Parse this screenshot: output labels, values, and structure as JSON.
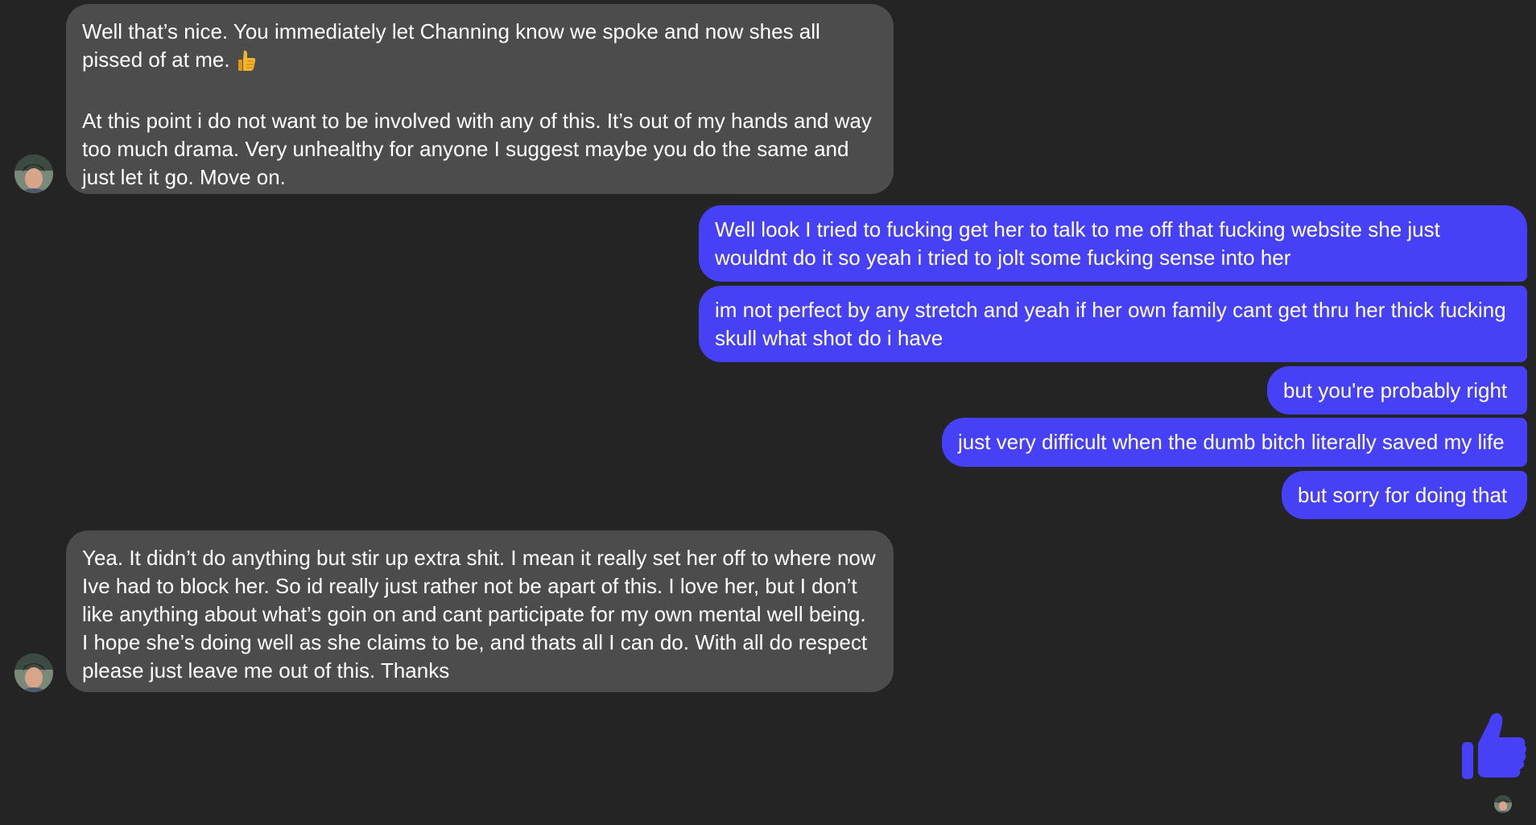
{
  "conversation": {
    "messages": [
      {
        "sender": "them",
        "text": "Well that’s nice. You immediately let Channing know we spoke and now shes all pissed of at me. ",
        "emoji": "thumbs-up",
        "text2": "\n\nAt this point i do not want to be involved with any of this. It’s out of my hands and way too much drama. Very unhealthy for anyone I suggest maybe you do the same and just let it go. Move on."
      },
      {
        "sender": "me",
        "text": "Well look I tried to fucking get her to talk to me off that fucking website she just wouldnt do it so yeah i tried to jolt some fucking sense into her"
      },
      {
        "sender": "me",
        "text": "im not perfect by any stretch and yeah if her own family cant get thru her thick fucking skull what shot do i have"
      },
      {
        "sender": "me",
        "text": "but you're probably right"
      },
      {
        "sender": "me",
        "text": "just very difficult when the dumb bitch literally saved my life"
      },
      {
        "sender": "me",
        "text": "but sorry for doing that"
      },
      {
        "sender": "them",
        "text": "Yea. It didn’t do anything but stir up extra shit. I mean it really set her off to where now Ive had to block her. So id really just rather not be apart of this. I love her, but I don’t like anything about what’s goin on and cant participate for my own mental well being. I hope she’s doing well as she claims to be, and thats all I can do. With all do respect please just leave me out of this. Thanks"
      }
    ],
    "reaction_icon": "thumbs-up-icon"
  },
  "colors": {
    "background": "#242424",
    "incoming_bubble": "#4c4c4c",
    "outgoing_bubble": "#4640f7",
    "text": "#ffffff"
  }
}
